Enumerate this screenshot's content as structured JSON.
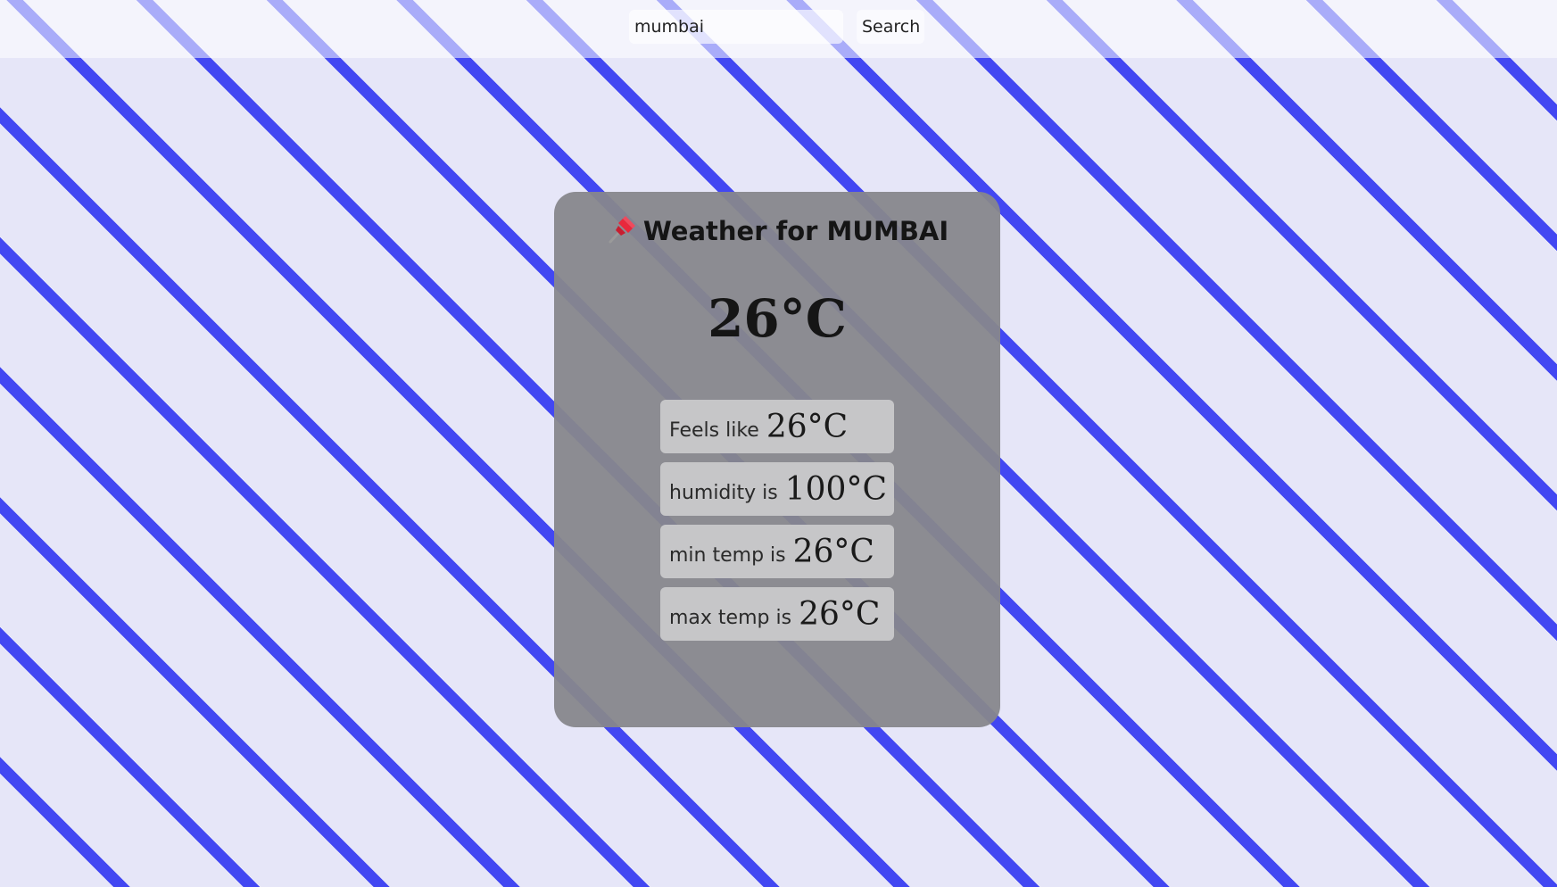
{
  "search": {
    "value": "mumbai",
    "button_label": "Search"
  },
  "card": {
    "title": "Weather for MUMBAI",
    "pin_icon": "pushpin-icon",
    "temperature": "26°C",
    "stats": [
      {
        "label": "Feels like",
        "value": "26°C"
      },
      {
        "label": "humidity is",
        "value": "100°C"
      },
      {
        "label": "min temp is",
        "value": "26°C"
      },
      {
        "label": "max temp is",
        "value": "26°C"
      }
    ]
  },
  "colors": {
    "background": "#e6e6f8",
    "stripe": "#4247f2",
    "card": "#87878c",
    "stat_box": "#c6c6c8",
    "pin": "#e8283c"
  }
}
